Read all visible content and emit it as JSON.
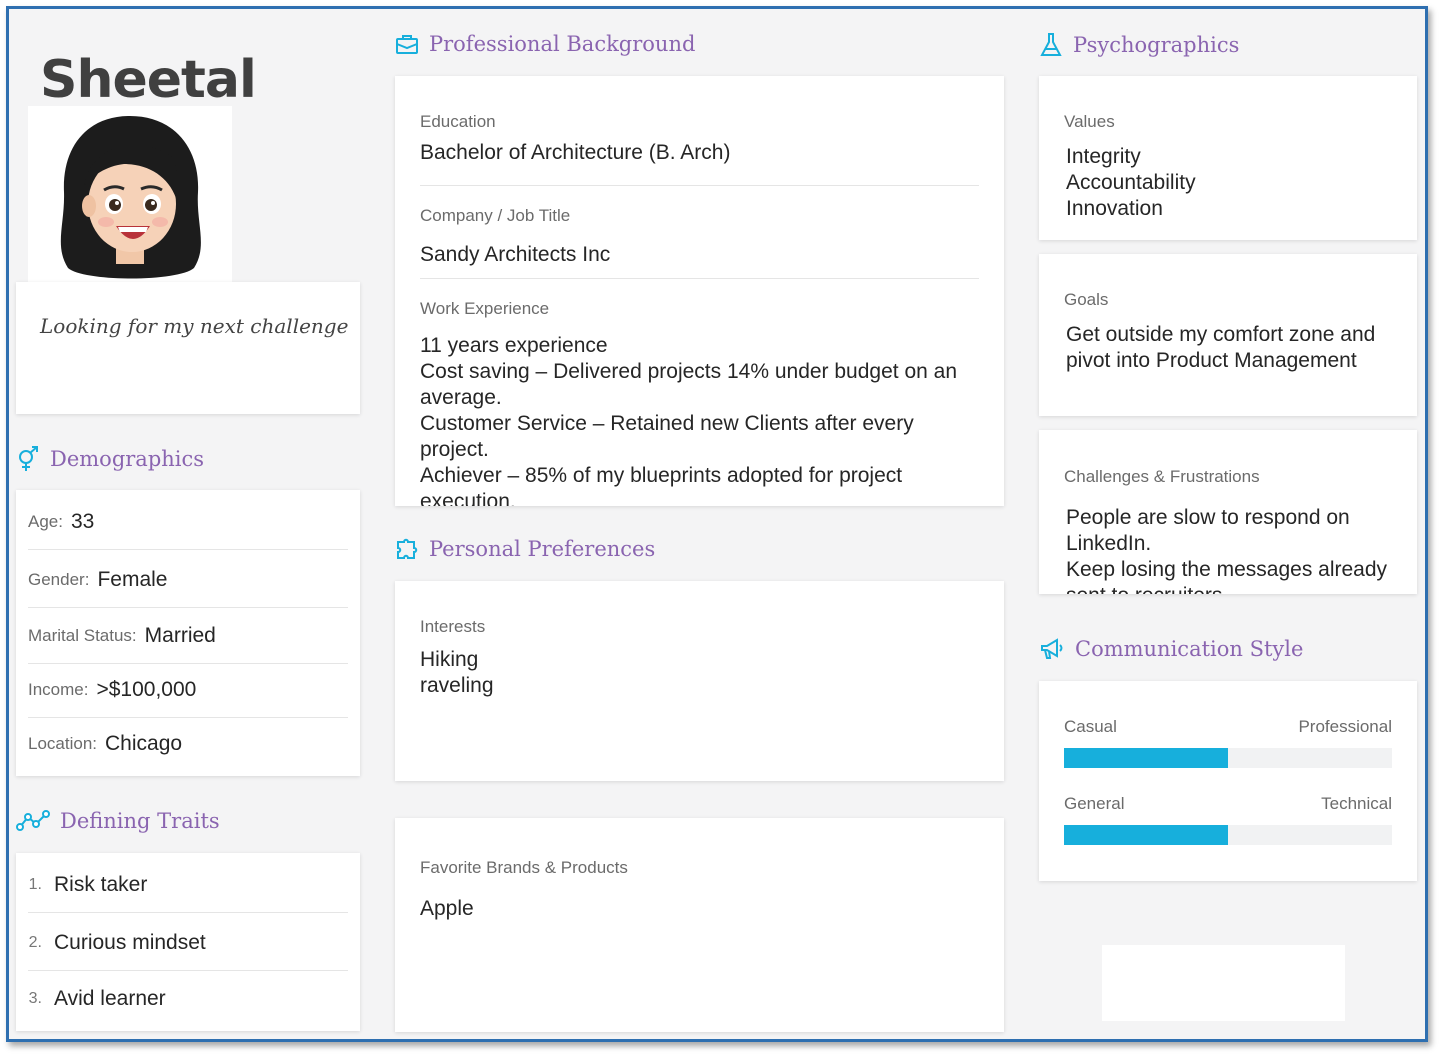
{
  "profile": {
    "name": "Sheetal",
    "tagline": "Looking for my next challenge"
  },
  "demographics": {
    "title": "Demographics",
    "icon": "gender-icon",
    "rows": [
      {
        "label": "Age:",
        "value": "33"
      },
      {
        "label": "Gender:",
        "value": "Female"
      },
      {
        "label": "Marital Status:",
        "value": "Married"
      },
      {
        "label": "Income:",
        "value": ">$100,000"
      },
      {
        "label": "Location:",
        "value": "Chicago"
      }
    ]
  },
  "traits": {
    "title": "Defining Traits",
    "icon": "trend-line-icon",
    "items": [
      {
        "num": "1.",
        "text": "Risk taker"
      },
      {
        "num": "2.",
        "text": "Curious mindset"
      },
      {
        "num": "3.",
        "text": "Avid learner"
      }
    ]
  },
  "professional": {
    "title": "Professional Background",
    "icon": "briefcase-icon",
    "education_label": "Education",
    "education": "Bachelor of Architecture (B. Arch)",
    "company_label": "Company / Job Title",
    "company": "Sandy Architects Inc",
    "experience_label": "Work Experience",
    "experience": [
      "11 years experience",
      "Cost saving – Delivered projects 14% under budget on an",
      "average.",
      "Customer Service – Retained new Clients after every",
      "project.",
      "Achiever – 85% of my blueprints adopted for project",
      "execution."
    ]
  },
  "preferences": {
    "title": "Personal Preferences",
    "icon": "puzzle-icon",
    "interests_label": "Interests",
    "interests": [
      "Hiking",
      "raveling"
    ],
    "brands_label": "Favorite Brands & Products",
    "brands": "Apple"
  },
  "psychographics": {
    "title": "Psychographics",
    "icon": "flask-icon",
    "values_label": "Values",
    "values": [
      "Integrity",
      "Accountability",
      "Innovation"
    ],
    "goals_label": "Goals",
    "goals": [
      "Get outside my comfort zone and",
      "pivot  into Product Management"
    ],
    "challenges_label": "Challenges & Frustrations",
    "challenges": [
      "People are slow to respond on",
      "LinkedIn.",
      "Keep losing the messages already",
      "sent to recruiters."
    ]
  },
  "communication": {
    "title": "Communication Style",
    "icon": "megaphone-icon",
    "sliders": [
      {
        "left": "Casual",
        "right": "Professional",
        "level": 0.5
      },
      {
        "left": "General",
        "right": "Technical",
        "level": 0.5
      }
    ]
  },
  "colors": {
    "accent": "#17afdc",
    "heading": "#8a64b0",
    "frame": "#2e6fb0"
  }
}
